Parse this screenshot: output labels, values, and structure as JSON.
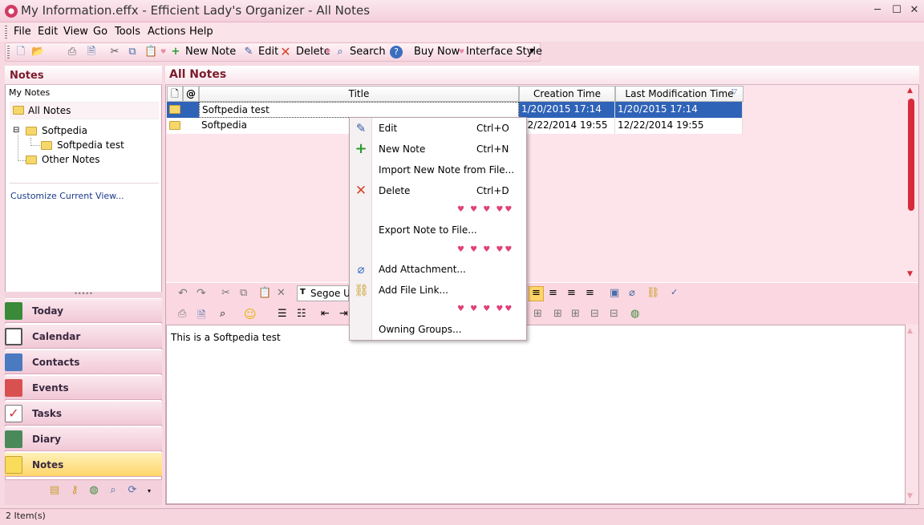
{
  "window": {
    "title": "My Information.effx - Efficient Lady's Organizer - All Notes",
    "min_label": "─",
    "max_label": "☐",
    "close_label": "✕"
  },
  "menu": [
    "File",
    "Edit",
    "View",
    "Go",
    "Tools",
    "Actions",
    "Help"
  ],
  "toolbar": {
    "new_note": "New Note",
    "edit": "Edit",
    "delete": "Delete",
    "search": "Search",
    "buy_now": "Buy Now",
    "interface_style": "Interface Style"
  },
  "left": {
    "header": "Notes",
    "my_notes": "My Notes",
    "all_notes": "All Notes",
    "tree": {
      "softpedia": "Softpedia",
      "softpedia_test": "Softpedia test",
      "other_notes": "Other Notes"
    },
    "customize": "Customize Current View...",
    "nav": {
      "today": "Today",
      "calendar": "Calendar",
      "contacts": "Contacts",
      "events": "Events",
      "tasks": "Tasks",
      "diary": "Diary",
      "notes": "Notes"
    }
  },
  "main": {
    "header": "All Notes",
    "columns": {
      "title": "Title",
      "creation": "Creation Time",
      "modified": "Last Modification Time"
    },
    "rows": [
      {
        "title": "Softpedia test",
        "created": "1/20/2015 17:14",
        "modified": "1/20/2015 17:14"
      },
      {
        "title": "Softpedia",
        "created": "12/22/2014 19:55",
        "modified": "12/22/2014 19:55"
      }
    ],
    "font_name": "Segoe UI",
    "editor_text": "This is a Softpedia test"
  },
  "context_menu": {
    "edit": "Edit",
    "edit_sc": "Ctrl+O",
    "new_note": "New Note",
    "new_note_sc": "Ctrl+N",
    "import": "Import New Note from File...",
    "delete": "Delete",
    "delete_sc": "Ctrl+D",
    "export": "Export Note to File...",
    "add_attachment": "Add Attachment...",
    "add_file_link": "Add File Link...",
    "owning_groups": "Owning Groups..."
  },
  "status": {
    "items": "2 Item(s)"
  },
  "colors": {
    "accent": "#d72b3a",
    "selection": "#2f63b8",
    "active_nav": "#ffd56a"
  }
}
